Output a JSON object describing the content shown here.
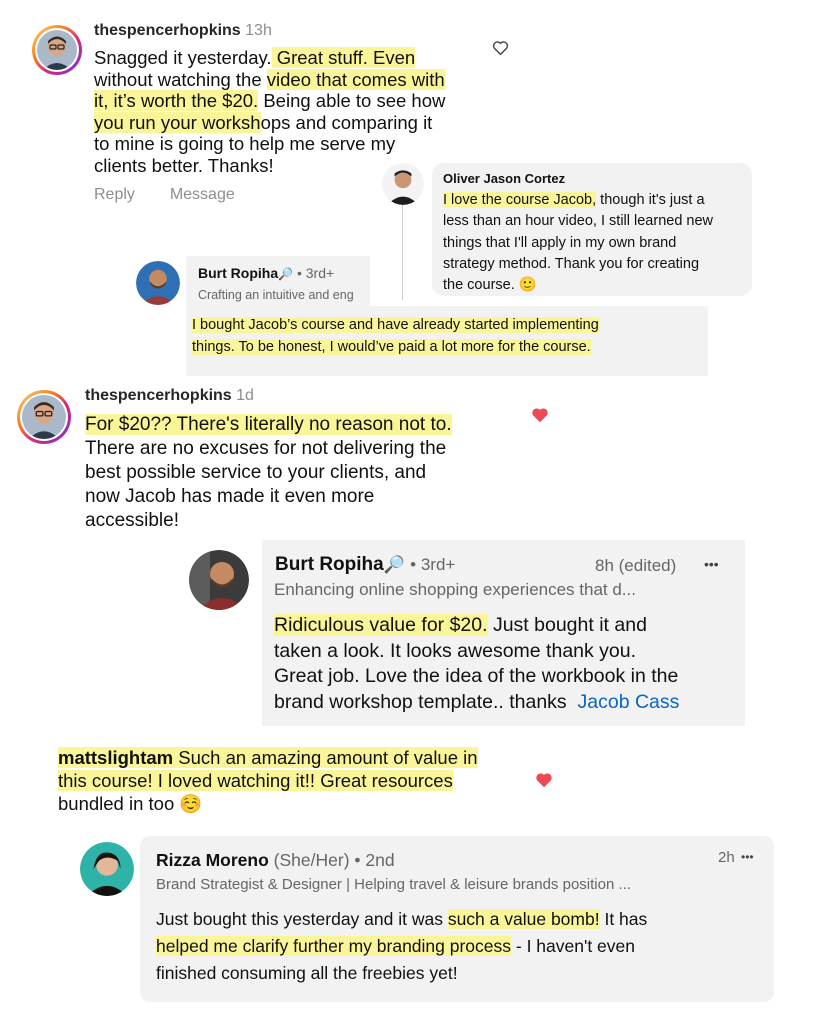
{
  "c1": {
    "username": "thespencerhopkins",
    "time": "13h",
    "lines": [
      [
        {
          "t": "Snagged it yesterday."
        },
        {
          "t": " Great stuff. Even",
          "h": true
        }
      ],
      [
        {
          "t": "without watching the "
        },
        {
          "t": "video that comes with",
          "h": true
        }
      ],
      [
        {
          "t": "it, it’s worth the $20.",
          "h": true
        },
        {
          "t": " Being able to see how"
        }
      ],
      [
        {
          "t": "you run your worksh",
          "h": true
        },
        {
          "t": "ops and comparing it"
        }
      ],
      [
        {
          "t": "to mine is going to help me serve my"
        }
      ],
      [
        {
          "t": "clients better. Thanks!"
        }
      ]
    ],
    "reply": "Reply",
    "message": "Message"
  },
  "oliver": {
    "name": "Oliver Jason Cortez",
    "lines": [
      [
        {
          "t": "I love the course Jacob,",
          "h": true
        },
        {
          "t": " though it's just a"
        }
      ],
      [
        {
          "t": "less than an hour video, I still learned new"
        }
      ],
      [
        {
          "t": "things that I'll apply in my own brand"
        }
      ],
      [
        {
          "t": "strategy method. Thank you for creating"
        }
      ],
      [
        {
          "t": "the course. "
        },
        {
          "t": "🙂"
        }
      ]
    ]
  },
  "burt1": {
    "name": "Burt Ropiha",
    "magnifier": "🔎",
    "degree": "• 3rd+",
    "headline": "Crafting an intuitive and eng",
    "lines": [
      [
        {
          "t": "I bought Jacob’s course and have already started implementing",
          "h": true
        }
      ],
      [
        {
          "t": "things. To be honest, I would’ve paid a lot more for the course.",
          "h": true
        }
      ]
    ]
  },
  "c2": {
    "username": "thespencerhopkins",
    "time": "1d",
    "lines": [
      [
        {
          "t": "For $20?? There's literally no reason not to.",
          "h": true
        }
      ],
      [
        {
          "t": "There are no excuses for not delivering the"
        }
      ],
      [
        {
          "t": "best possible service to your clients, and"
        }
      ],
      [
        {
          "t": "now Jacob has made it even more"
        }
      ],
      [
        {
          "t": "accessible!"
        }
      ]
    ]
  },
  "burt2": {
    "name": "Burt Ropiha",
    "magnifier": "🔎",
    "degree": "• 3rd+",
    "meta": "8h (edited)",
    "more": "•••",
    "headline": "Enhancing online shopping experiences that d...",
    "lines": [
      [
        {
          "t": "Ridiculous value for $20.",
          "h": true
        },
        {
          "t": " Just bought it and"
        }
      ],
      [
        {
          "t": "taken a look. It looks awesome thank you."
        }
      ],
      [
        {
          "t": "Great job. Love the idea of the workbook in the"
        }
      ],
      [
        {
          "t": "brand workshop template.. thanks  "
        },
        {
          "t": "Jacob Cass",
          "link": true
        }
      ]
    ]
  },
  "c3": {
    "lines": [
      [
        {
          "t": "mattslightam",
          "h": true,
          "b": true
        },
        {
          "t": " Such an amazing amount of value in",
          "h": true
        }
      ],
      [
        {
          "t": "this course! I loved watching it!! Great resources",
          "h": true
        }
      ],
      [
        {
          "t": "bundled in too "
        },
        {
          "t": "☺️"
        }
      ]
    ]
  },
  "rizza": {
    "name": "Rizza Moreno",
    "pronouns": "(She/Her)",
    "degree": "• 2nd",
    "meta": "2h",
    "more": "•••",
    "headline": "Brand Strategist & Designer | Helping travel & leisure brands position ...",
    "lines": [
      [
        {
          "t": "Just bought this yesterday and it was "
        },
        {
          "t": "such a value bomb!",
          "h": true
        },
        {
          "t": " It has"
        }
      ],
      [
        {
          "t": "helped me clarify further my branding process",
          "h": true
        },
        {
          "t": " - I haven't even"
        }
      ],
      [
        {
          "t": "finished consuming all the freebies yet!"
        }
      ]
    ]
  },
  "colors": {
    "highlight": "#fbf59a",
    "heart": "#ed4956",
    "link": "#0a66c2"
  },
  "icons": [
    "heart-outline-icon",
    "heart-filled-icon",
    "magnifier-icon",
    "more-icon"
  ]
}
